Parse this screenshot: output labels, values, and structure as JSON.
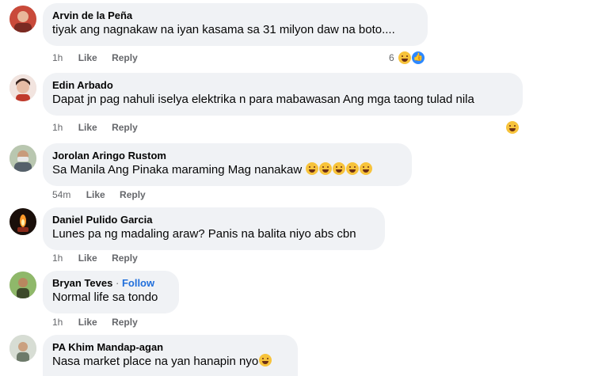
{
  "comments": [
    {
      "name": "Arvin de la Peña",
      "text": "tiyak ang nagnakaw na iyan kasama sa 31 milyon daw na boto....",
      "time": "1h",
      "like": "Like",
      "reply": "Reply",
      "reaction_count": "6"
    },
    {
      "name": "Edin Arbado",
      "text": "Dapat jn pag nahuli iselya elektrika n para mabawasan Ang mga taong tulad nila",
      "time": "1h",
      "like": "Like",
      "reply": "Reply"
    },
    {
      "name": "Jorolan Aringo Rustom",
      "text": "Sa Manila Ang Pinaka maraming Mag nanakaw",
      "time": "54m",
      "like": "Like",
      "reply": "Reply"
    },
    {
      "name": "Daniel Pulido Garcia",
      "text": "Lunes pa ng madaling araw? Panis na balita niyo abs cbn",
      "time": "1h",
      "like": "Like",
      "reply": "Reply"
    },
    {
      "name": "Bryan Teves",
      "separator": "·",
      "follow": "Follow",
      "text": "Normal life sa tondo",
      "time": "1h",
      "like": "Like",
      "reply": "Reply"
    },
    {
      "name": "PA Khim Mandap-agan",
      "text": "Nasa market place na yan hanapin nyo"
    }
  ],
  "colors": {
    "bubble": "#f0f2f5",
    "meta": "#65676b",
    "follow": "#216fdb",
    "like_badge": "#2d88ff"
  },
  "icons": [
    "laughing-emoji-icon",
    "like-reaction-icon"
  ]
}
